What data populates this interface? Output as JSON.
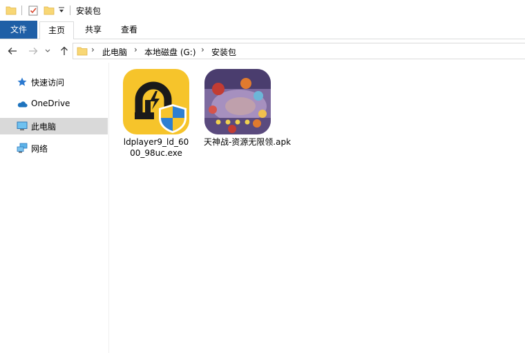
{
  "window": {
    "title": "安装包"
  },
  "ribbon": {
    "tabs": [
      {
        "label": "文件"
      },
      {
        "label": "主页"
      },
      {
        "label": "共享"
      },
      {
        "label": "查看"
      }
    ],
    "accent": "#1f5fa6"
  },
  "address": {
    "breadcrumbs": [
      {
        "label": "此电脑"
      },
      {
        "label": "本地磁盘 (G:)"
      },
      {
        "label": "安装包"
      }
    ]
  },
  "sidebar": {
    "items": [
      {
        "label": "快速访问",
        "icon": "star-icon"
      },
      {
        "label": "OneDrive",
        "icon": "cloud-icon"
      },
      {
        "label": "此电脑",
        "icon": "computer-icon",
        "selected": true
      },
      {
        "label": "网络",
        "icon": "network-icon"
      }
    ]
  },
  "files": [
    {
      "name": "ldplayer9_ld_6000_98uc.exe",
      "name_line1": "ldplayer9_ld_60",
      "name_line2": "00_98uc.exe",
      "icon": "ldplayer-app-icon"
    },
    {
      "name": "天神战-资源无限领.apk",
      "icon": "game-apk-icon"
    }
  ]
}
